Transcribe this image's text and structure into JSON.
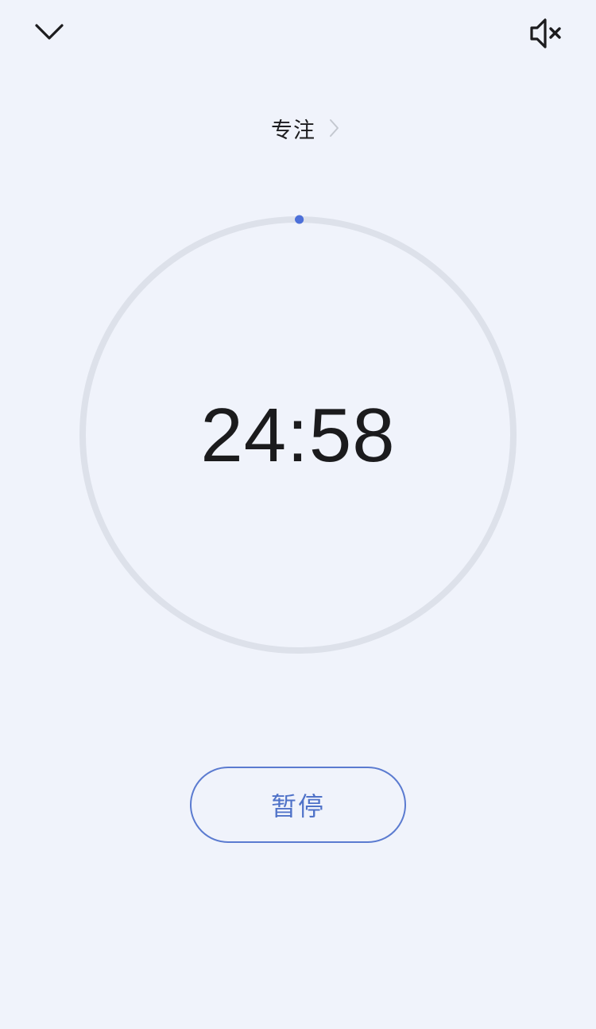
{
  "header": {
    "collapse_icon": "chevron-down-icon",
    "sound_icon": "speaker-muted-icon"
  },
  "mode": {
    "label": "专注",
    "chevron_icon": "chevron-right-icon"
  },
  "timer": {
    "time": "24:58",
    "progress": 0.001,
    "ring_color": "#dde1ea",
    "indicator_color": "#4d70d9"
  },
  "controls": {
    "pause_label": "暂停",
    "accent_color": "#5b7bd0"
  },
  "colors": {
    "background": "#f0f3fb",
    "text": "#1c1c1e"
  }
}
